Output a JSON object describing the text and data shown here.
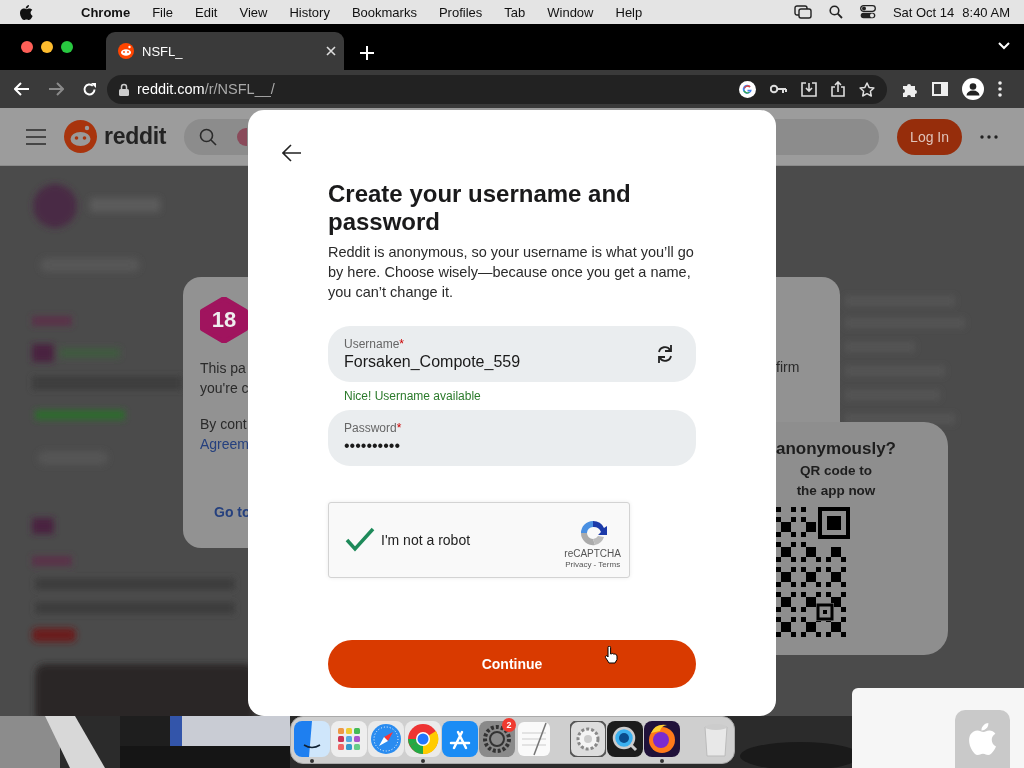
{
  "menu_bar": {
    "app_name": "Chrome",
    "menus": [
      "File",
      "Edit",
      "View",
      "History",
      "Bookmarks",
      "Profiles",
      "Tab",
      "Window",
      "Help"
    ],
    "date": "Sat Oct 14",
    "time": "8:40 AM"
  },
  "browser": {
    "tabs": [
      {
        "title": "NSFL_",
        "selected": true
      }
    ],
    "url_host": "reddit.com",
    "url_path": "/r/NSFL__/"
  },
  "reddit_header": {
    "logo_text": "reddit",
    "login_button": "Log In"
  },
  "age_card": {
    "badge": "18",
    "lines": [
      "This pa",
      "you're c"
    ],
    "consent_text": "By cont",
    "link": "Agreem",
    "right_text": "firm",
    "go_button": "Go to"
  },
  "qr_card": {
    "title": "anonymously?",
    "lines": [
      "QR code to",
      "the app now"
    ]
  },
  "signup_modal": {
    "title": "Create your username and password",
    "description": "Reddit is anonymous, so your username is what you’ll go by here. Choose wisely—because once you get a name, you can’t change it.",
    "username": {
      "label": "Username",
      "required_mark": "*",
      "value": "Forsaken_Compote_559"
    },
    "username_status": "Nice! Username available",
    "password": {
      "label": "Password",
      "required_mark": "*",
      "value": "••••••••••"
    },
    "captcha": {
      "checked": true,
      "label": "I'm not a robot",
      "brand": "reCAPTCHA",
      "links": "Privacy - Terms"
    },
    "continue_button": "Continue"
  },
  "dock": {
    "items": [
      {
        "kind": "finder",
        "running": true
      },
      {
        "kind": "launchpad",
        "running": false
      },
      {
        "kind": "safari",
        "running": false
      },
      {
        "kind": "chrome",
        "running": true
      },
      {
        "kind": "appstore",
        "running": false
      },
      {
        "kind": "settings",
        "running": false,
        "badge": "2"
      },
      {
        "kind": "notes",
        "running": false
      },
      {
        "kind": "separator"
      },
      {
        "kind": "prefs",
        "running": false
      },
      {
        "kind": "quicktime",
        "running": false
      },
      {
        "kind": "firefox",
        "running": true
      },
      {
        "kind": "separator"
      },
      {
        "kind": "trash",
        "running": false
      }
    ]
  }
}
